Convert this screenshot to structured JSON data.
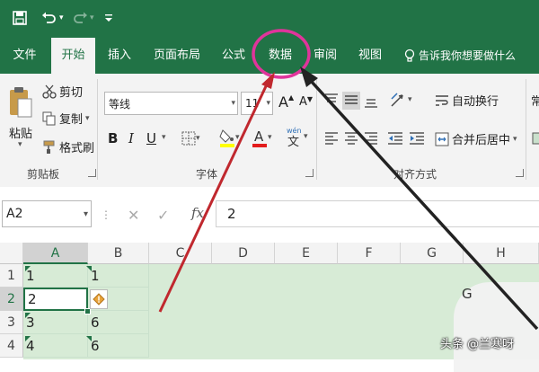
{
  "quick_access": {
    "save_icon": "save-icon",
    "undo_icon": "undo-icon",
    "redo_icon": "redo-icon",
    "customize_icon": "customize-icon"
  },
  "tabs": [
    {
      "label": "文件"
    },
    {
      "label": "开始"
    },
    {
      "label": "插入"
    },
    {
      "label": "页面布局"
    },
    {
      "label": "公式"
    },
    {
      "label": "数据"
    },
    {
      "label": "审阅"
    },
    {
      "label": "视图"
    }
  ],
  "tell_me": "告诉我你想要做什么",
  "clipboard": {
    "paste": "粘贴",
    "cut": "剪切",
    "copy": "复制",
    "format_painter": "格式刷",
    "label": "剪贴板"
  },
  "font": {
    "name": "等线",
    "size": "11",
    "bold": "B",
    "italic": "I",
    "underline": "U",
    "label": "字体",
    "grow": "A",
    "shrink": "A"
  },
  "alignment": {
    "wrap": "自动换行",
    "merge": "合并后居中",
    "label": "对齐方式"
  },
  "number_cut": "常",
  "formula_bar": {
    "name_box": "A2",
    "fx": "fx",
    "value": "2"
  },
  "columns": [
    "A",
    "B",
    "C",
    "D",
    "E",
    "F",
    "G",
    "H"
  ],
  "rows": [
    "1",
    "2",
    "3",
    "4"
  ],
  "cells": {
    "A": [
      "1",
      "2",
      "3",
      "4"
    ],
    "B": [
      "1",
      "",
      "6",
      "6"
    ]
  },
  "overlay_letter": "G",
  "watermark": "头条 @兰寒呀",
  "colors": {
    "accent": "#217346",
    "annotation_red": "#c0282e",
    "annotation_pink": "#e0349b",
    "selection_green": "#d7ebd6"
  }
}
